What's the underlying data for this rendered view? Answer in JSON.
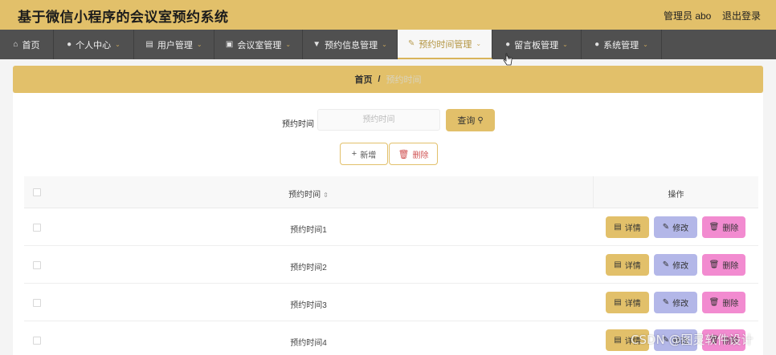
{
  "header": {
    "title": "基于微信小程序的会议室预约系统",
    "user_label": "管理员 abo",
    "logout_label": "退出登录"
  },
  "nav": {
    "items": [
      {
        "label": "首页",
        "icon": "home-icon"
      },
      {
        "label": "个人中心",
        "icon": "user-icon"
      },
      {
        "label": "用户管理",
        "icon": "document-icon"
      },
      {
        "label": "会议室管理",
        "icon": "building-icon"
      },
      {
        "label": "预约信息管理",
        "icon": "bookmark-icon"
      },
      {
        "label": "预约时间管理",
        "icon": "edit-icon",
        "active": true
      },
      {
        "label": "留言板管理",
        "icon": "user-icon"
      },
      {
        "label": "系统管理",
        "icon": "user-icon"
      }
    ]
  },
  "breadcrumb": {
    "home": "首页",
    "separator": "/",
    "current": "预约时间"
  },
  "search": {
    "label": "预约时间",
    "placeholder": "预约时间",
    "button_label": "查询"
  },
  "actions": {
    "add_label": "新增",
    "delete_label": "删除"
  },
  "table": {
    "columns": [
      "预约时间",
      "操作"
    ],
    "rows": [
      "预约时间1",
      "预约时间2",
      "预约时间3",
      "预约时间4"
    ],
    "row_actions": {
      "detail": "详情",
      "edit": "修改",
      "delete": "删除"
    }
  },
  "watermark": "CSDN @图灵软件设计",
  "colors": {
    "accent": "#e2c06a",
    "nav_bg": "#505050",
    "edit_button": "#b3b7e8",
    "delete_button": "#f28bd0"
  }
}
